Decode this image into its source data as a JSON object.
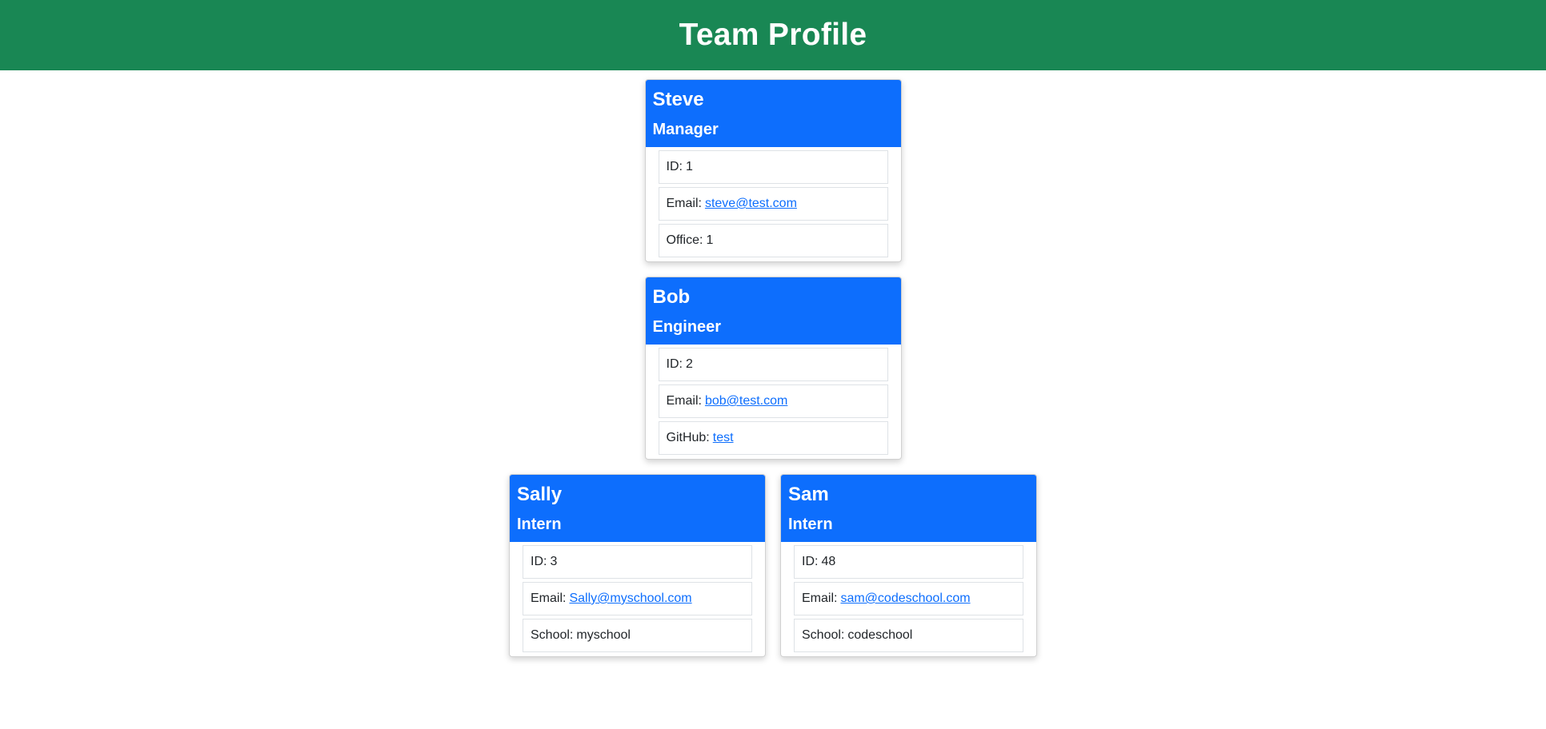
{
  "header": {
    "title": "Team Profile",
    "background": "#198754"
  },
  "accent": "#0d6efd",
  "team": [
    {
      "name": "Steve",
      "role": "Manager",
      "items": [
        {
          "label": "ID:",
          "value": "1",
          "link": false
        },
        {
          "label": "Email:",
          "value": "steve@test.com",
          "link": true
        },
        {
          "label": "Office:",
          "value": "1",
          "link": false
        }
      ]
    },
    {
      "name": "Bob",
      "role": "Engineer",
      "items": [
        {
          "label": "ID:",
          "value": "2",
          "link": false
        },
        {
          "label": "Email:",
          "value": "bob@test.com",
          "link": true
        },
        {
          "label": "GitHub:",
          "value": "test",
          "link": true
        }
      ]
    },
    {
      "name": "Sally",
      "role": "Intern",
      "items": [
        {
          "label": "ID:",
          "value": "3",
          "link": false
        },
        {
          "label": "Email:",
          "value": "Sally@myschool.com",
          "link": true
        },
        {
          "label": "School:",
          "value": "myschool",
          "link": false
        }
      ]
    },
    {
      "name": "Sam",
      "role": "Intern",
      "items": [
        {
          "label": "ID:",
          "value": "48",
          "link": false
        },
        {
          "label": "Email:",
          "value": "sam@codeschool.com",
          "link": true
        },
        {
          "label": "School:",
          "value": "codeschool",
          "link": false
        }
      ]
    }
  ]
}
